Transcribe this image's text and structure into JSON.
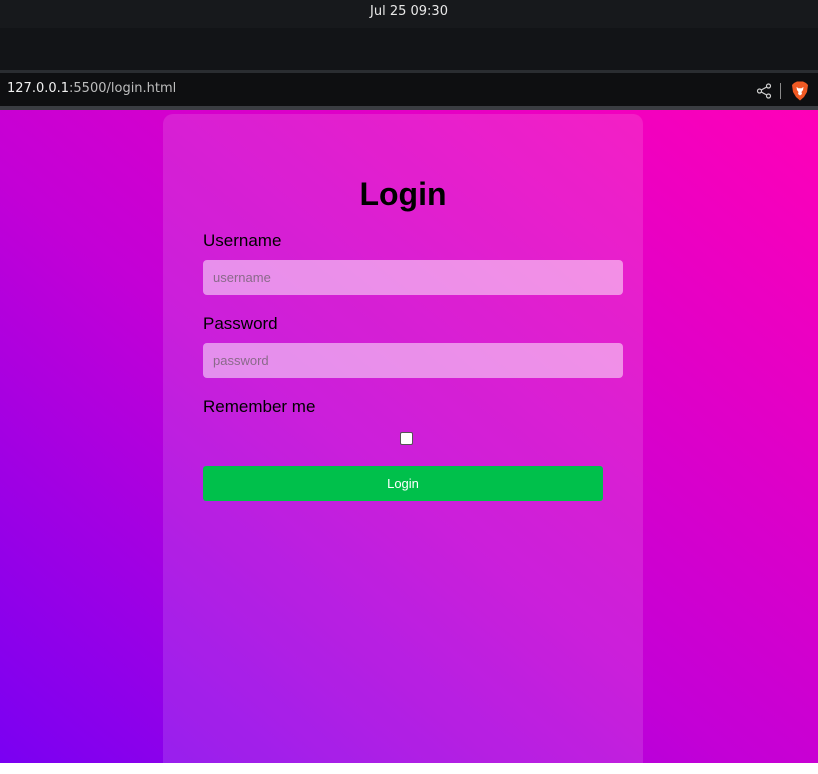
{
  "system_bar": {
    "datetime": "Jul 25  09:30"
  },
  "browser": {
    "url_host": "127.0.0.1",
    "url_path": ":5500/login.html"
  },
  "login_form": {
    "title": "Login",
    "username_label": "Username",
    "username_placeholder": "username",
    "username_value": "",
    "password_label": "Password",
    "password_placeholder": "password",
    "password_value": "",
    "remember_label": "Remember me",
    "remember_checked": false,
    "submit_label": "Login"
  },
  "colors": {
    "submit_button": "#00c04b",
    "gradient_start": "#7a00f2",
    "gradient_mid": "#c300d6",
    "gradient_end": "#ff00b8"
  },
  "icons": {
    "share": "share-icon",
    "brave": "brave-lion-icon"
  }
}
